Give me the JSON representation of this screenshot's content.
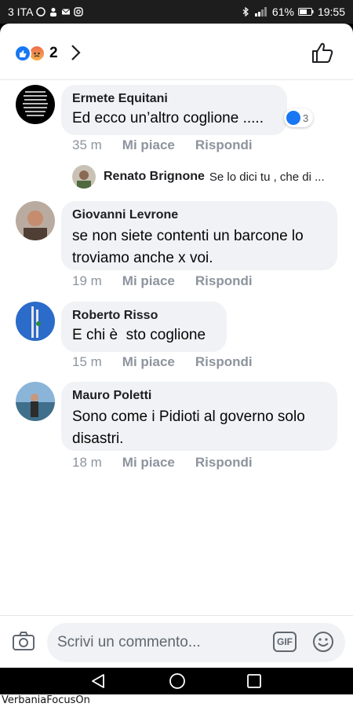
{
  "status_bar": {
    "carrier": "3 ITA",
    "battery": "61%",
    "time": "19:55",
    "icons": [
      "whatsapp-icon",
      "person-icon",
      "mail-icon",
      "instagram-icon",
      "bluetooth-icon",
      "signal-icon",
      "battery-icon"
    ]
  },
  "reactions_header": {
    "count": "2",
    "icons": [
      "like-reaction-icon",
      "angry-reaction-icon",
      "chevron-right-icon",
      "thumbs-up-icon"
    ]
  },
  "comments": [
    {
      "author": "Ermete Equitani",
      "text": "Ed ecco un’altro coglione .....",
      "time": "35 m",
      "like": "Mi piace",
      "reply": "Rispondi",
      "reaction_count": "3"
    },
    {
      "author": "Giovanni Levrone",
      "text": "se non siete contenti un barcone lo troviamo anche x voi.",
      "time": "19 m",
      "like": "Mi piace",
      "reply": "Rispondi"
    },
    {
      "author": "Roberto Risso",
      "text": "E chi è  sto coglione",
      "time": "15 m",
      "like": "Mi piace",
      "reply": "Rispondi"
    },
    {
      "author": "Mauro Poletti",
      "text": "Sono come i Pidioti al governo solo disastri.",
      "time": "18 m",
      "like": "Mi piace",
      "reply": "Rispondi"
    }
  ],
  "reply_preview": {
    "author": "Renato Brignone",
    "text": "Se lo dici tu , che di ..."
  },
  "composer": {
    "placeholder": "Scrivi un commento...",
    "gif_label": "GIF",
    "icons": [
      "camera-icon",
      "emoji-icon"
    ]
  },
  "navbar": {
    "icons": [
      "back-icon",
      "home-icon",
      "recent-apps-icon"
    ]
  },
  "watermark": "VerbaniaFocusOn",
  "colors": {
    "facebook_blue": "#1877f2",
    "bubble_gray": "#f0f2f5",
    "meta_gray": "#8d949e"
  }
}
